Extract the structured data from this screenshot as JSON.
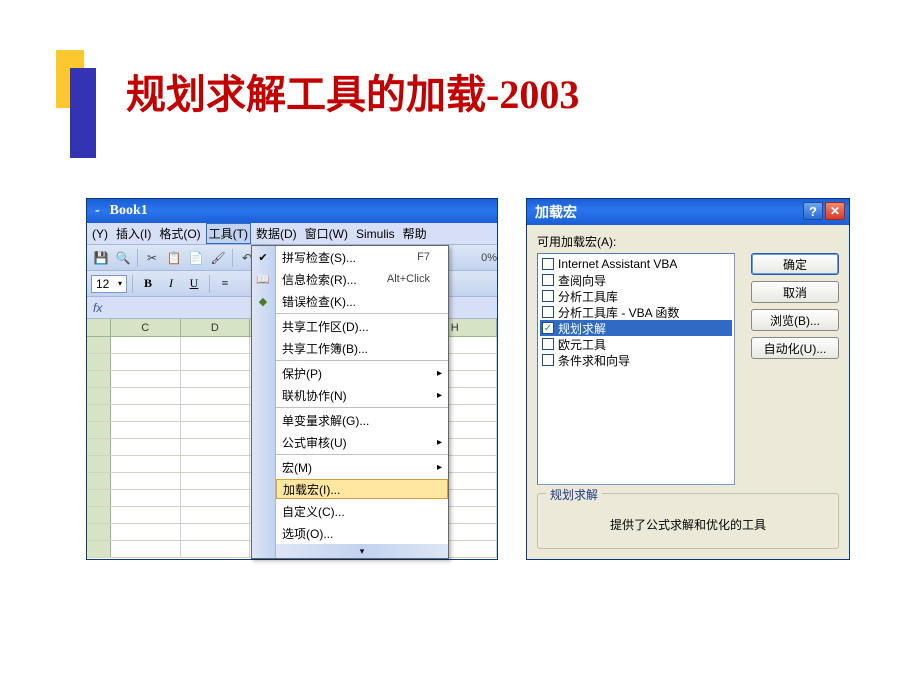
{
  "slide": {
    "title": "规划求解工具的加载-2003"
  },
  "excel": {
    "titlebar": {
      "dash": "-",
      "book": "Book1"
    },
    "menubar": {
      "items": [
        "(Y)",
        "插入(I)",
        "格式(O)",
        "工具(T)",
        "数据(D)",
        "窗口(W)",
        "Simulis",
        "帮助"
      ]
    },
    "format": {
      "fontsize": "12",
      "bold": "B",
      "italic": "I",
      "underline": "U"
    },
    "toolbar": {
      "percent": "0%"
    },
    "formula_fx": "fx",
    "columns": [
      "",
      "C",
      "D",
      "H"
    ],
    "dropdown": {
      "items": [
        {
          "label": "拼写检查(S)...",
          "shortcut": "F7",
          "icon": "✔"
        },
        {
          "label": "信息检索(R)...",
          "shortcut": "Alt+Click",
          "icon": "📖"
        },
        {
          "label": "错误检查(K)...",
          "icon": "◆"
        },
        {
          "label": "共享工作区(D)...",
          "sep_before": true
        },
        {
          "label": "共享工作簿(B)..."
        },
        {
          "label": "保护(P)",
          "submenu": true,
          "sep_before": true
        },
        {
          "label": "联机协作(N)",
          "submenu": true
        },
        {
          "label": "单变量求解(G)...",
          "sep_before": true
        },
        {
          "label": "公式审核(U)",
          "submenu": true
        },
        {
          "label": "宏(M)",
          "submenu": true,
          "sep_before": true
        },
        {
          "label": "加载宏(I)...",
          "highlighted": true
        },
        {
          "label": "自定义(C)..."
        },
        {
          "label": "选项(O)..."
        }
      ]
    }
  },
  "dialog": {
    "title": "加载宏",
    "label": "可用加载宏(A):",
    "addins": [
      {
        "label": "Internet Assistant VBA",
        "checked": false
      },
      {
        "label": "查阅向导",
        "checked": false
      },
      {
        "label": "分析工具库",
        "checked": false
      },
      {
        "label": "分析工具库 - VBA 函数",
        "checked": false
      },
      {
        "label": "规划求解",
        "checked": true,
        "selected": true
      },
      {
        "label": "欧元工具",
        "checked": false
      },
      {
        "label": "条件求和向导",
        "checked": false
      }
    ],
    "buttons": {
      "ok": "确定",
      "cancel": "取消",
      "browse": "浏览(B)...",
      "automation": "自动化(U)..."
    },
    "description": {
      "caption": "规划求解",
      "text": "提供了公式求解和优化的工具"
    },
    "help_glyph": "?",
    "close_glyph": "✕"
  }
}
